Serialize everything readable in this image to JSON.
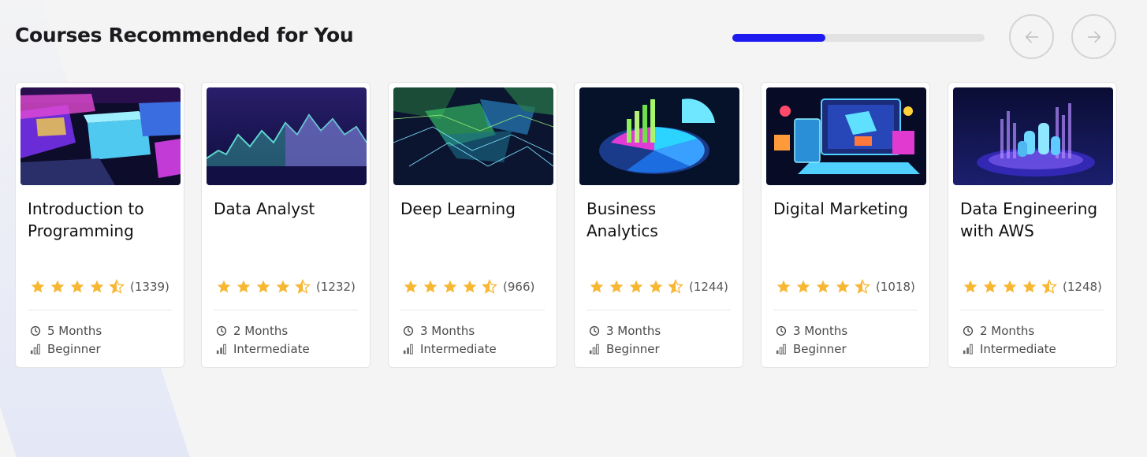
{
  "section": {
    "title": "Courses Recommended for You",
    "progress": 0.37
  },
  "navigation": {
    "prev_icon": "arrow-left-icon",
    "next_icon": "arrow-right-icon"
  },
  "colors": {
    "accent": "#1f1bf0",
    "star": "#f7b733",
    "track": "#e2e2e2"
  },
  "courses": [
    {
      "name": "Introduction to Programming",
      "rating_icons": "4.5 stars",
      "reviews": "(1339)",
      "duration": "5 Months",
      "level": "Beginner"
    },
    {
      "name": "Data Analyst",
      "rating_icons": "4.5 stars",
      "reviews": "(1232)",
      "duration": "2 Months",
      "level": "Intermediate"
    },
    {
      "name": "Deep Learning",
      "rating_icons": "4.5 stars",
      "reviews": "(966)",
      "duration": "3 Months",
      "level": "Intermediate"
    },
    {
      "name": "Business Analytics",
      "rating_icons": "4.5 stars",
      "reviews": "(1244)",
      "duration": "3 Months",
      "level": "Beginner"
    },
    {
      "name": "Digital Marketing",
      "rating_icons": "4.5 stars",
      "reviews": "(1018)",
      "duration": "3 Months",
      "level": "Beginner"
    },
    {
      "name": "Data Engineering with AWS",
      "rating_icons": "4.5 stars",
      "reviews": "(1248)",
      "duration": "2 Months",
      "level": "Intermediate"
    }
  ]
}
